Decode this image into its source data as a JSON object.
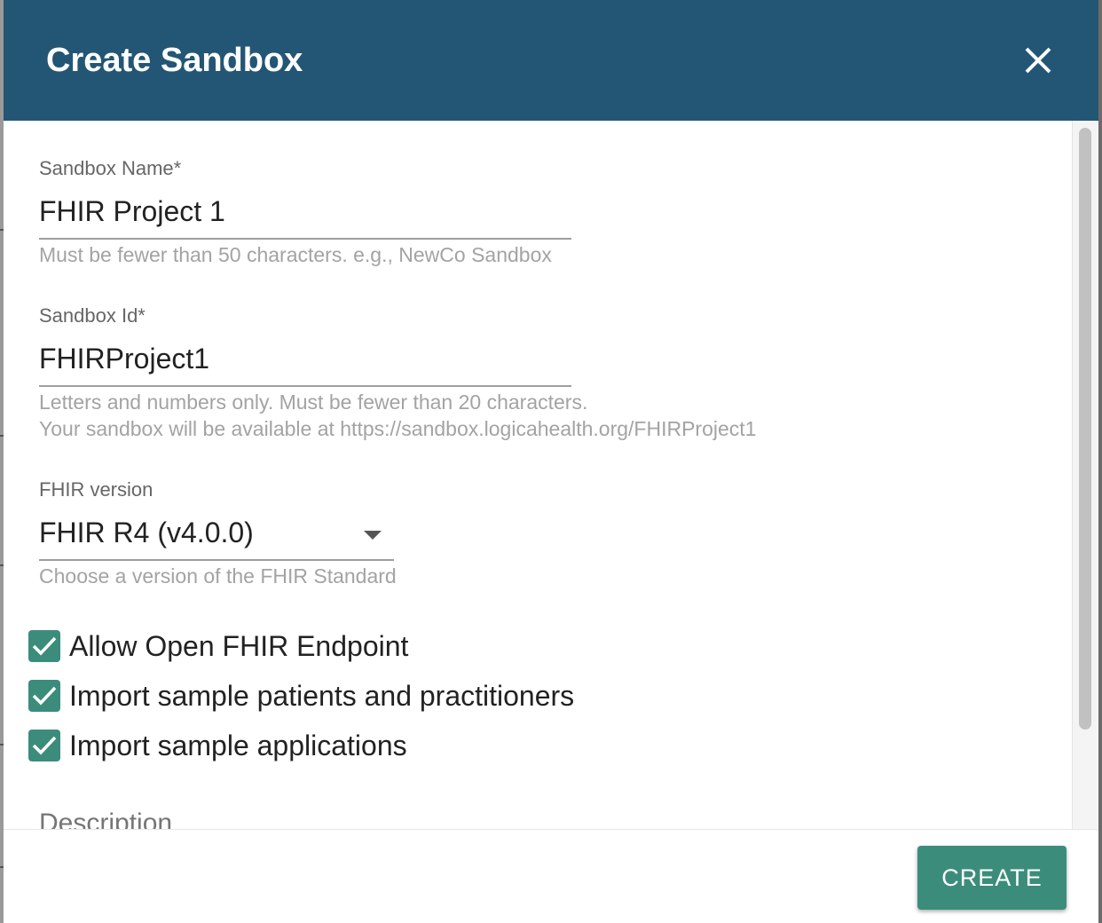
{
  "dialog": {
    "title": "Create Sandbox",
    "header_color": "#235674",
    "accent_color": "#3c8c7c"
  },
  "fields": {
    "sandbox_name": {
      "label": "Sandbox Name*",
      "value": "FHIR Project 1",
      "helper": "Must be fewer than 50 characters. e.g., NewCo Sandbox"
    },
    "sandbox_id": {
      "label": "Sandbox Id*",
      "value": "FHIRProject1",
      "helper_line1": "Letters and numbers only. Must be fewer than 20 characters.",
      "helper_line2": "Your sandbox will be available at https://sandbox.logicahealth.org/FHIRProject1"
    },
    "fhir_version": {
      "label": "FHIR version",
      "selected": "FHIR R4 (v4.0.0)",
      "helper": "Choose a version of the FHIR Standard"
    }
  },
  "options": [
    {
      "label": "Allow Open FHIR Endpoint",
      "checked": true
    },
    {
      "label": "Import sample patients and practitioners",
      "checked": true
    },
    {
      "label": "Import sample applications",
      "checked": true
    }
  ],
  "description_label": "Description",
  "footer": {
    "create_label": "CREATE"
  }
}
